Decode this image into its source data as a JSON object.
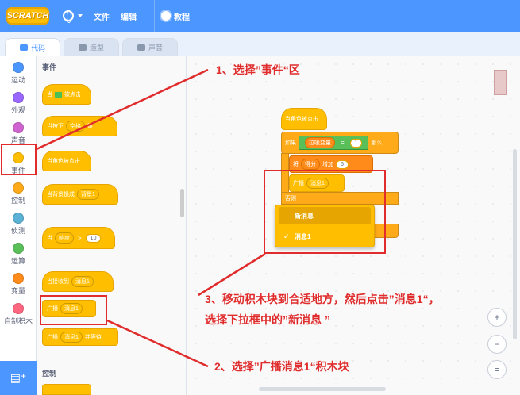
{
  "menubar": {
    "logo_text": "SCRATCH",
    "file": "文件",
    "edit": "编辑",
    "tutorials": "教程"
  },
  "tabs": [
    {
      "label": "代码"
    },
    {
      "label": "造型"
    },
    {
      "label": "声音"
    }
  ],
  "categories": [
    {
      "label": "运动",
      "color": "#4c97ff"
    },
    {
      "label": "外观",
      "color": "#9966ff"
    },
    {
      "label": "声音",
      "color": "#cf63cf"
    },
    {
      "label": "事件",
      "color": "#ffbf00"
    },
    {
      "label": "控制",
      "color": "#ffab19"
    },
    {
      "label": "侦测",
      "color": "#5cb1d6"
    },
    {
      "label": "运算",
      "color": "#59c059"
    },
    {
      "label": "变量",
      "color": "#ff8c1a"
    },
    {
      "label": "自制积木",
      "color": "#ff6680"
    }
  ],
  "palette": {
    "section_events": "事件",
    "section_control": "控制",
    "blocks": {
      "when_flag": "当",
      "when_flag_suffix": "被点击",
      "when_key": "当按下",
      "when_key_value": "空格",
      "when_key_suffix": "键",
      "when_sprite_clicked": "当角色被点击",
      "when_backdrop": "当背景换成",
      "backdrop_value": "背景1",
      "when_gt_prefix": "当",
      "loudness": "响度",
      "gt_value": "10",
      "when_receive": "当接收到",
      "receive_value": "消息1",
      "broadcast": "广播",
      "broadcast_value": "消息1",
      "broadcast_wait": "广播",
      "broadcast_wait_value": "消息1",
      "broadcast_wait_suffix": "并等待"
    }
  },
  "workspace": {
    "script": {
      "hat": "当角色被点击",
      "if": "如果",
      "var_name": "拉吸变量",
      "eq": "=",
      "eq_value": "1",
      "then": "那么",
      "change": "将",
      "score": "得分",
      "change_by": "增加",
      "change_value": "5",
      "broadcast": "广播",
      "broadcast_value": "消息1",
      "else": "否则"
    },
    "dropdown": {
      "items": [
        {
          "label": "新消息"
        },
        {
          "label": "消息1"
        }
      ],
      "checkmark": "✓"
    },
    "zoom_in": "+",
    "zoom_out": "−",
    "zoom_reset": "="
  },
  "annotations": {
    "note1": "1、选择”事件“区",
    "note2": "2、选择”广播消息1“积木块",
    "note3": "3、移动积木块到合适地方，然后点击”消息1“，选择下拉框中的”新消息 ”"
  }
}
